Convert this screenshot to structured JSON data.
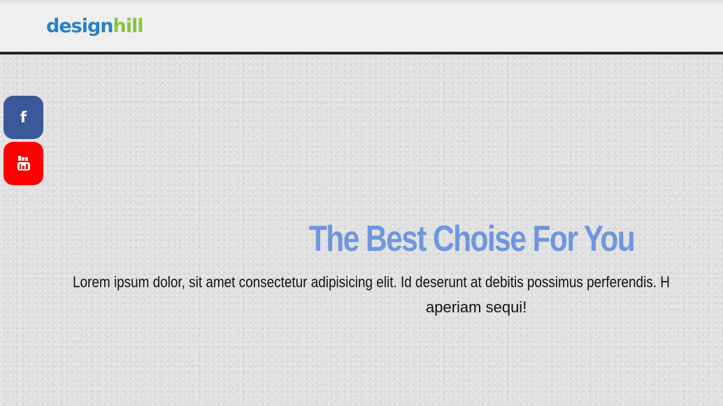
{
  "header": {
    "logo_part1": "design",
    "logo_part2": "hill",
    "brand_colors": {
      "primary": "#2b7fc6",
      "accent": "#87c540"
    }
  },
  "social": [
    {
      "name": "facebook",
      "icon": "facebook-icon",
      "color": "#3b5998"
    },
    {
      "name": "youtube",
      "icon": "youtube-icon",
      "color": "#ff0000"
    }
  ],
  "hero": {
    "title": "The Best Choise For You",
    "text_line1": "Lorem ipsum dolor, sit amet consectetur adipisicing elit. Id deserunt at debitis possimus perferendis. H",
    "text_line2": "aperiam sequi!",
    "title_color": "#6e97e0"
  }
}
